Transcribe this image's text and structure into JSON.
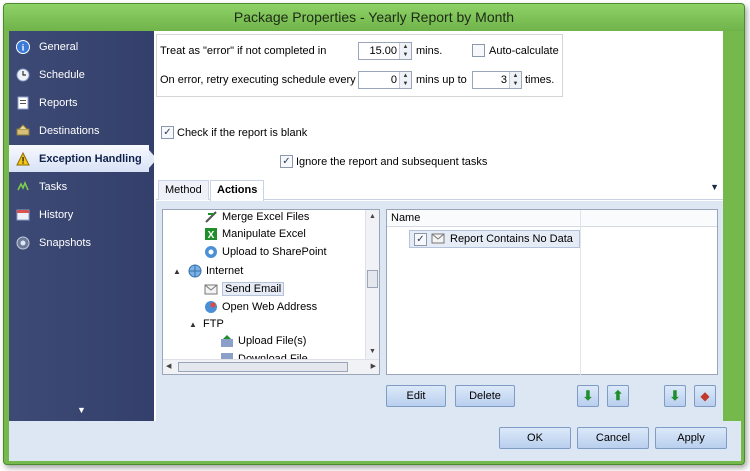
{
  "window": {
    "title": "Package Properties - Yearly Report by Month"
  },
  "sidebar": {
    "items": [
      {
        "label": "General",
        "icon": "info-icon"
      },
      {
        "label": "Schedule",
        "icon": "clock-icon"
      },
      {
        "label": "Reports",
        "icon": "report-icon"
      },
      {
        "label": "Destinations",
        "icon": "destinations-icon"
      },
      {
        "label": "Exception Handling",
        "icon": "warning-icon",
        "active": true
      },
      {
        "label": "Tasks",
        "icon": "tasks-icon"
      },
      {
        "label": "History",
        "icon": "history-icon"
      },
      {
        "label": "Snapshots",
        "icon": "snapshots-icon"
      }
    ]
  },
  "settings": {
    "error_label": "Treat as \"error\" if not completed in",
    "error_value": "15.00",
    "mins_label": "mins.",
    "autocalc_label": "Auto-calculate",
    "retry_label": "On error, retry  executing schedule every",
    "retry_value": "0",
    "mins_up_to_label": "mins up to",
    "times_value": "3",
    "times_label": "times.",
    "blank_label": "Check if the report is blank",
    "ignore_label": "Ignore the report and subsequent tasks"
  },
  "tabs": [
    {
      "label": "Method"
    },
    {
      "label": "Actions",
      "active": true
    }
  ],
  "tree": {
    "items": [
      {
        "label": "Merge Excel Files",
        "icon": "merge-excel-icon"
      },
      {
        "label": "Manipulate Excel",
        "icon": "excel-icon"
      },
      {
        "label": "Upload to SharePoint",
        "icon": "sharepoint-icon"
      },
      {
        "label": "Internet",
        "icon": "globe-icon",
        "expander": "▲"
      },
      {
        "label": "Send Email",
        "icon": "email-icon",
        "selected": true
      },
      {
        "label": "Open Web Address",
        "icon": "web-icon"
      },
      {
        "label": "FTP",
        "icon": "ftp-icon",
        "expander": "▲"
      },
      {
        "label": "Upload File(s)",
        "icon": "upload-icon"
      },
      {
        "label": "Download File",
        "icon": "download-icon"
      }
    ]
  },
  "list": {
    "header": "Name",
    "rows": [
      {
        "label": "Report Contains No Data",
        "checked": true
      }
    ]
  },
  "buttons": {
    "edit": "Edit",
    "delete": "Delete",
    "ok": "OK",
    "cancel": "Cancel",
    "apply": "Apply"
  },
  "colors": {
    "frame": "#75b94d",
    "sidebar": "#3d4a75",
    "panel": "#dde6f3",
    "button": "#b9cfee"
  }
}
